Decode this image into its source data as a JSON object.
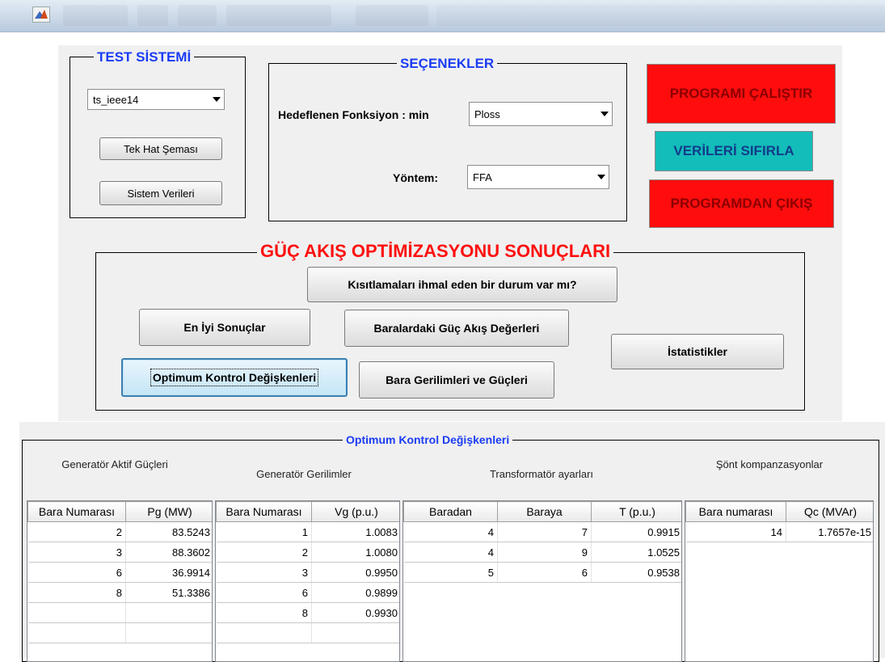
{
  "sections": {
    "test_system": "TEST SİSTEMİ",
    "options": "SEÇENEKLER",
    "results": "GÜÇ AKIŞ OPTİMİZASYONU SONUÇLARI",
    "table_panel": "Optimum Kontrol Değişkenleri"
  },
  "test_system": {
    "selected": "ts_ieee14",
    "btn_single_line": "Tek Hat Şeması",
    "btn_system_data": "Sistem Verileri"
  },
  "options": {
    "objective_label": "Hedeflenen Fonksiyon : min",
    "objective_value": "Ploss",
    "method_label": "Yöntem:",
    "method_value": "FFA"
  },
  "actions": {
    "run": "PROGRAMI ÇALIŞTIR",
    "reset": "VERİLERİ SIFIRLA",
    "exit": "PROGRAMDAN ÇIKIŞ"
  },
  "results": {
    "constraints": "Kısıtlamaları ihmal eden bir durum var mı?",
    "best": "En İyi Sonuçlar",
    "flows": "Baralardaki Güç Akış Değerleri",
    "stats": "İstatistikler",
    "control": "Optimum Kontrol Değişkenleri",
    "voltages": "Bara Gerilimleri ve Güçleri"
  },
  "tables": {
    "gen_active": {
      "title": "Generatör Aktif Güçleri",
      "cols": [
        "Bara Numarası",
        "Pg (MW)"
      ],
      "rows": [
        [
          "2",
          "83.5243"
        ],
        [
          "3",
          "88.3602"
        ],
        [
          "6",
          "36.9914"
        ],
        [
          "8",
          "51.3386"
        ]
      ]
    },
    "gen_voltage": {
      "title": "Generatör Gerilimler",
      "cols": [
        "Bara Numarası",
        "Vg (p.u.)"
      ],
      "rows": [
        [
          "1",
          "1.0083"
        ],
        [
          "2",
          "1.0080"
        ],
        [
          "3",
          "0.9950"
        ],
        [
          "6",
          "0.9899"
        ],
        [
          "8",
          "0.9930"
        ]
      ]
    },
    "transformer": {
      "title": "Transformatör ayarları",
      "cols": [
        "Baradan",
        "Baraya",
        "T (p.u.)"
      ],
      "rows": [
        [
          "4",
          "7",
          "0.9915"
        ],
        [
          "4",
          "9",
          "1.0525"
        ],
        [
          "5",
          "6",
          "0.9538"
        ]
      ]
    },
    "shunt": {
      "title": "Şönt kompanzasyonlar",
      "cols": [
        "Bara numarası",
        "Qc (MVAr)"
      ],
      "rows": [
        [
          "14",
          "1.7657e-15"
        ]
      ]
    }
  },
  "colors": {
    "run_button": "#ff0d0d",
    "reset_button": "#13bdb9",
    "exit_button": "#ff0d0d",
    "title_blue": "#1b3cf5",
    "title_red": "#ff1010"
  }
}
